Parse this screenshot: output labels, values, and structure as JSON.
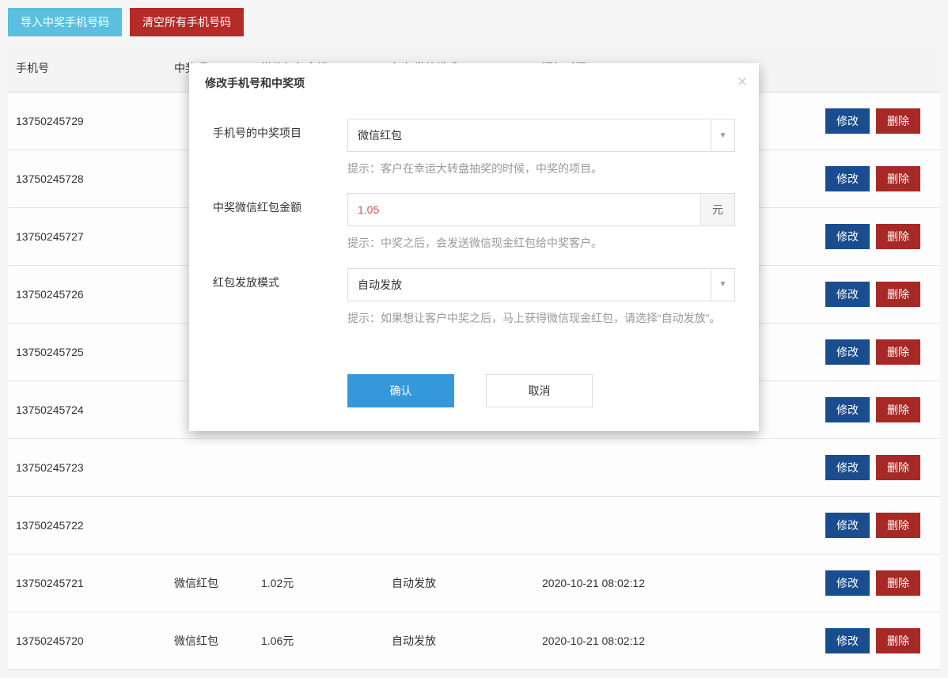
{
  "toolbar": {
    "import_label": "导入中奖手机号码",
    "clear_label": "清空所有手机号码"
  },
  "table": {
    "headers": {
      "phone": "手机号",
      "prize": "中奖项",
      "amount": "微信红包金额",
      "mode": "红包发放模式",
      "time": "添加时间",
      "actions": ""
    },
    "edit_label": "修改",
    "delete_label": "删除",
    "rows": [
      {
        "phone": "13750245729",
        "prize": "",
        "amount": "",
        "mode": "",
        "time": ""
      },
      {
        "phone": "13750245728",
        "prize": "",
        "amount": "",
        "mode": "",
        "time": ""
      },
      {
        "phone": "13750245727",
        "prize": "",
        "amount": "",
        "mode": "",
        "time": ""
      },
      {
        "phone": "13750245726",
        "prize": "",
        "amount": "",
        "mode": "",
        "time": ""
      },
      {
        "phone": "13750245725",
        "prize": "",
        "amount": "",
        "mode": "",
        "time": ""
      },
      {
        "phone": "13750245724",
        "prize": "",
        "amount": "",
        "mode": "",
        "time": ""
      },
      {
        "phone": "13750245723",
        "prize": "",
        "amount": "",
        "mode": "",
        "time": ""
      },
      {
        "phone": "13750245722",
        "prize": "",
        "amount": "",
        "mode": "",
        "time": ""
      },
      {
        "phone": "13750245721",
        "prize": "微信红包",
        "amount": "1.02元",
        "mode": "自动发放",
        "time": "2020-10-21 08:02:12"
      },
      {
        "phone": "13750245720",
        "prize": "微信红包",
        "amount": "1.06元",
        "mode": "自动发放",
        "time": "2020-10-21 08:02:12"
      }
    ]
  },
  "modal": {
    "title": "修改手机号和中奖项",
    "close_label": "×",
    "fields": {
      "prize_project": {
        "label": "手机号的中奖项目",
        "value": "微信红包",
        "hint": "提示：客户在幸运大转盘抽奖的时候，中奖的项目。"
      },
      "amount": {
        "label": "中奖微信红包金额",
        "value": "1.05",
        "unit": "元",
        "hint": "提示：中奖之后，会发送微信现金红包给中奖客户。"
      },
      "mode": {
        "label": "红包发放模式",
        "value": "自动发放",
        "hint": "提示：如果想让客户中奖之后，马上获得微信现金红包，请选择“自动发放”。"
      }
    },
    "confirm_label": "确认",
    "cancel_label": "取消"
  }
}
